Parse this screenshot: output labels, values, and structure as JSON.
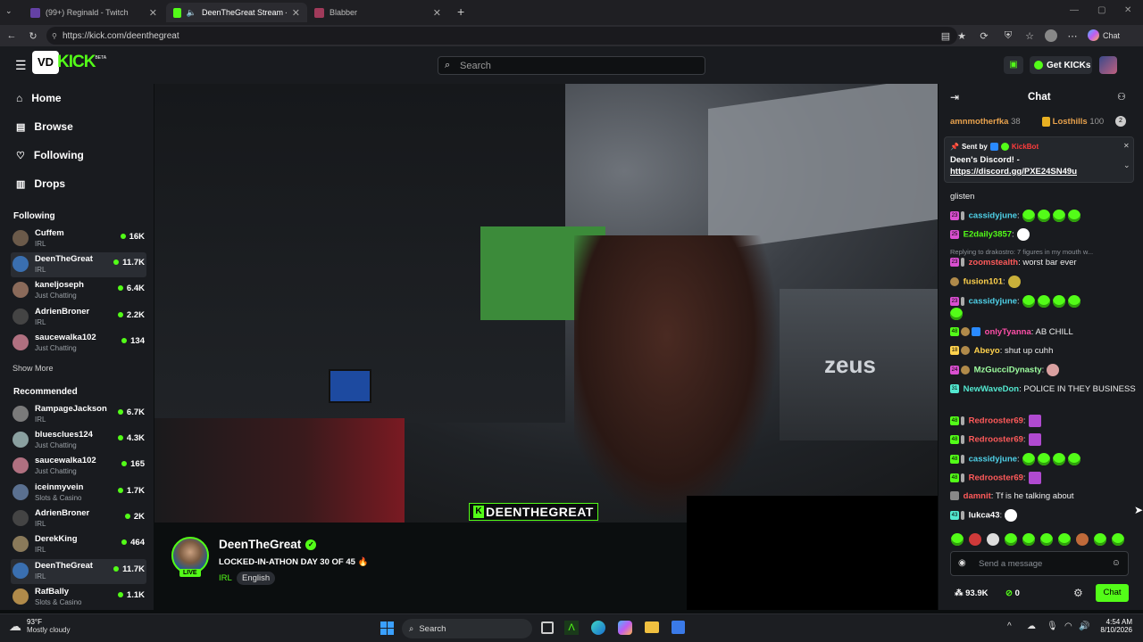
{
  "browser": {
    "tabs": [
      {
        "title": "(99+) Reginald - Twitch",
        "active": false
      },
      {
        "title": "DeenTheGreat Stream - Watc",
        "active": true
      },
      {
        "title": "Blabber",
        "active": false
      }
    ],
    "url": "https://kick.com/deenthegreat",
    "chat_button": "Chat"
  },
  "header": {
    "logo": "KICK",
    "logo_sup": "BETA",
    "search_placeholder": "Search",
    "get_kicks": "Get KICKs"
  },
  "sidebar": {
    "nav": [
      {
        "label": "Home",
        "icon": "home-icon"
      },
      {
        "label": "Browse",
        "icon": "browse-icon"
      },
      {
        "label": "Following",
        "icon": "heart-icon"
      },
      {
        "label": "Drops",
        "icon": "drops-icon"
      }
    ],
    "following_title": "Following",
    "following": [
      {
        "name": "Cuffem",
        "category": "IRL",
        "viewers": "16K"
      },
      {
        "name": "DeenTheGreat",
        "category": "IRL",
        "viewers": "11.7K",
        "selected": true
      },
      {
        "name": "kaneljoseph",
        "category": "Just Chatting",
        "viewers": "6.4K"
      },
      {
        "name": "AdrienBroner",
        "category": "IRL",
        "viewers": "2.2K"
      },
      {
        "name": "saucewalka102",
        "category": "Just Chatting",
        "viewers": "134"
      }
    ],
    "show_more": "Show More",
    "recommended_title": "Recommended",
    "recommended": [
      {
        "name": "RampageJackson",
        "category": "IRL",
        "viewers": "6.7K"
      },
      {
        "name": "bluesclues124",
        "category": "Just Chatting",
        "viewers": "4.3K"
      },
      {
        "name": "saucewalka102",
        "category": "Just Chatting",
        "viewers": "165"
      },
      {
        "name": "iceinmyvein",
        "category": "Slots & Casino",
        "viewers": "1.7K"
      },
      {
        "name": "AdrienBroner",
        "category": "IRL",
        "viewers": "2K"
      },
      {
        "name": "DerekKing",
        "category": "IRL",
        "viewers": "464"
      },
      {
        "name": "DeenTheGreat",
        "category": "IRL",
        "viewers": "11.7K",
        "selected": true
      },
      {
        "name": "RafBally",
        "category": "Slots & Casino",
        "viewers": "1.1K"
      }
    ]
  },
  "video": {
    "overlay_name": "DEENTHEGREAT"
  },
  "stream": {
    "streamer": "DeenTheGreat",
    "title": "LOCKED-IN-ATHON DAY 30 OF 45 🔥",
    "live_label": "LIVE",
    "tags": [
      "IRL",
      "English"
    ]
  },
  "chat": {
    "title": "Chat",
    "top_gifters": [
      {
        "name": "amnmotherfka",
        "count": "38"
      },
      {
        "name": "Losthills",
        "count": "100"
      }
    ],
    "pinned": {
      "sent_by_label": "Sent by",
      "sender": "KickBot",
      "message": "Deen's Discord! -",
      "link": "https://discord.gg/PXE24SN49u"
    },
    "messages": [
      {
        "user": "",
        "text": "glisten",
        "color": "#ffffff"
      },
      {
        "user": "cassidyjune",
        "text": "",
        "color": "#4fd1e8",
        "emotes": 4
      },
      {
        "user": "E2daily3857",
        "text": "",
        "color": "#53fc18",
        "emotes": 1
      },
      {
        "reply": "Replying to drakostro: 7 figures in my mouth w...",
        "user": "zoomstealth",
        "text": "worst bar ever",
        "color": "#ff5a5a"
      },
      {
        "user": "fusion101",
        "text": "",
        "color": "#ffd24d",
        "emotes": 1
      },
      {
        "user": "cassidyjune",
        "text": "",
        "color": "#4fd1e8",
        "emotes": 5
      },
      {
        "user": "onlyTyanna",
        "text": "AB CHILL",
        "color": "#ff4fa8"
      },
      {
        "user": "Abeyo",
        "text": "shut up cuhh",
        "color": "#ffd24d"
      },
      {
        "user": "MzGucciDynasty",
        "text": "",
        "color": "#9effa0",
        "emotes": 1
      },
      {
        "user": "NewWaveDon",
        "text": "POLICE IN THEY BUSINESS",
        "color": "#53e8d0"
      },
      {
        "user": "Redrooster69",
        "text": "",
        "color": "#ff5a5a",
        "emotes": 1
      },
      {
        "user": "Redrooster69",
        "text": "",
        "color": "#ff5a5a",
        "emotes": 1
      },
      {
        "user": "cassidyjune",
        "text": "",
        "color": "#4fd1e8",
        "emotes": 4
      },
      {
        "user": "Redrooster69",
        "text": "",
        "color": "#ff5a5a",
        "emotes": 1
      },
      {
        "user": "damnit",
        "text": "Tf is he talking about",
        "color": "#ff5a5a"
      },
      {
        "user": "lukca43",
        "text": "",
        "color": "#ffffff",
        "emotes": 1
      }
    ],
    "input_placeholder": "Send a message",
    "points": "93.9K",
    "kicks": "0",
    "send_button": "Chat"
  },
  "taskbar": {
    "weather_temp": "93°F",
    "weather_desc": "Mostly cloudy",
    "search_label": "Search",
    "time": "4:54 AM",
    "date": "8/10/2026"
  },
  "colors": {
    "accent": "#53fc18",
    "bg": "#0b0e0f",
    "panel": "#191b1f"
  }
}
